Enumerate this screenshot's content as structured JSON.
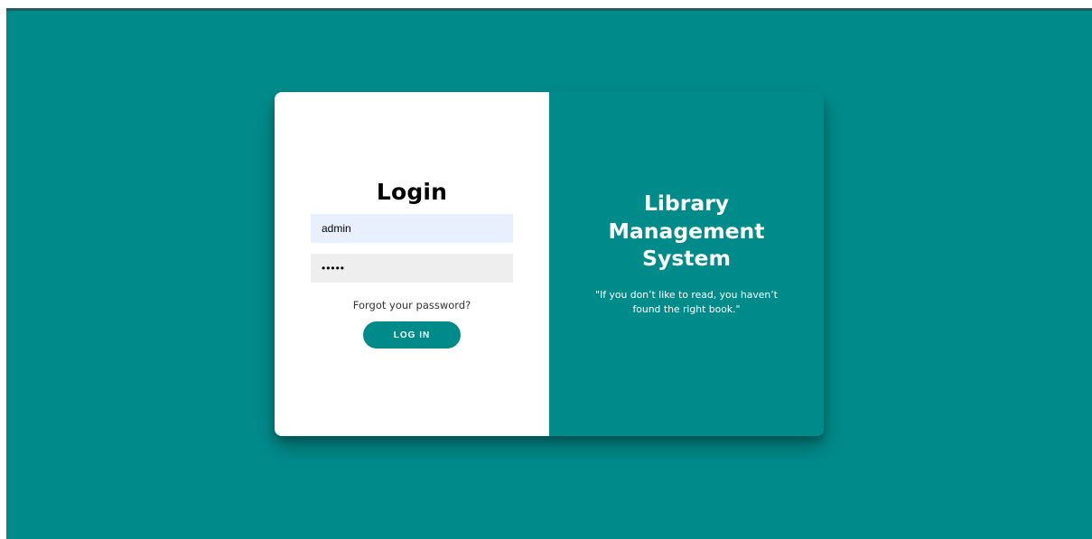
{
  "login": {
    "title": "Login",
    "username_value": "admin",
    "password_value": "•••••",
    "forgot_text": "Forgot your password?",
    "button_label": "LOG IN"
  },
  "info": {
    "title_lines": [
      "Library",
      "Management",
      "System"
    ],
    "quote": "\"If you don’t like to read, you haven’t found the right book.\""
  },
  "colors": {
    "background": "#008b8b",
    "card_left": "#ffffff",
    "username_bg": "#e8f0fe",
    "password_bg": "#eeeeee"
  }
}
